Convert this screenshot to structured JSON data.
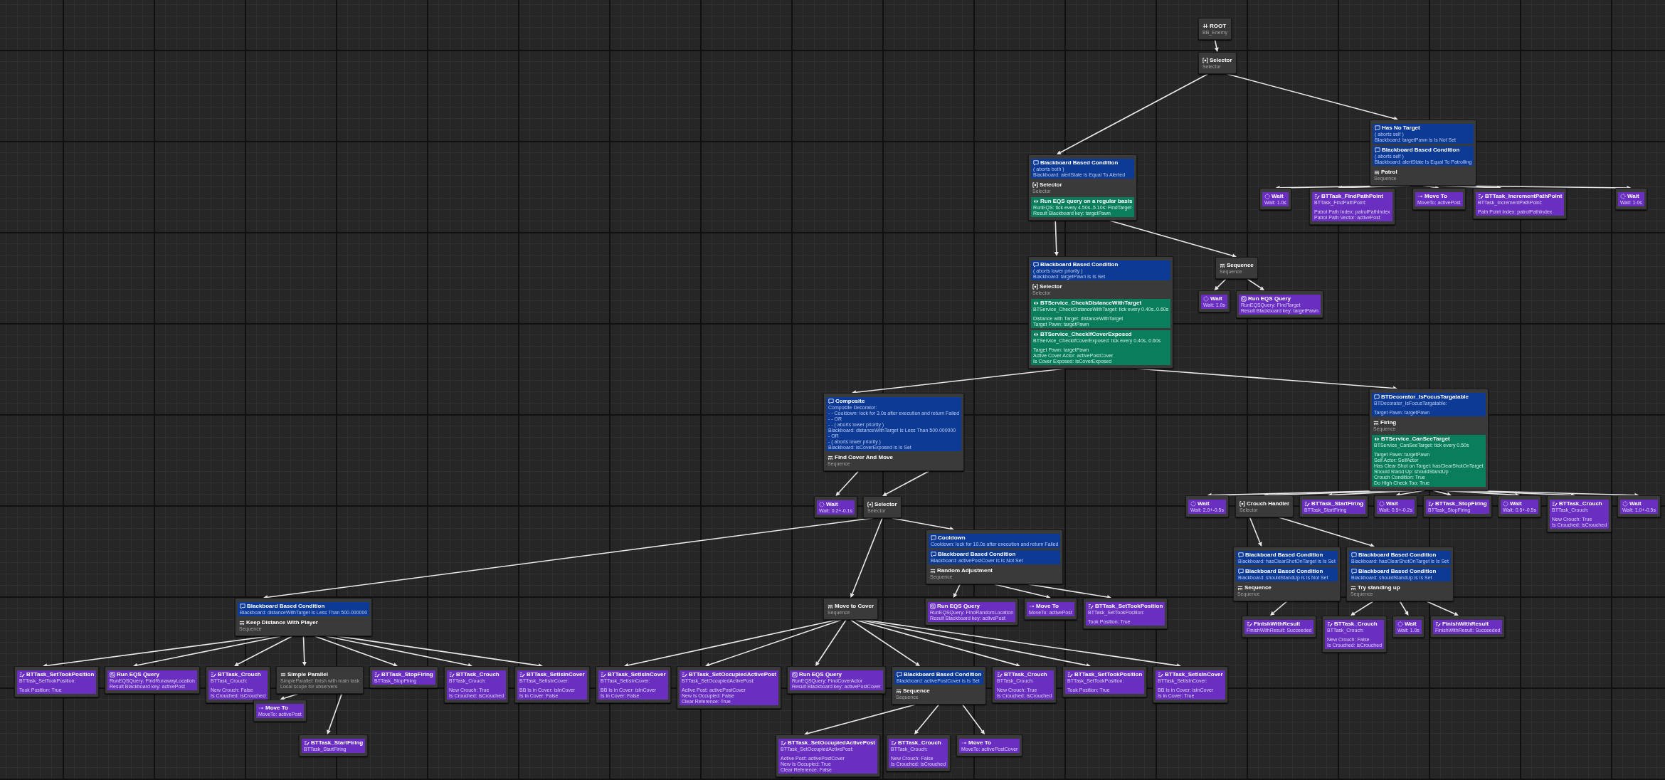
{
  "behavior_tree": {
    "sections": [
      {
        "kind": "root",
        "title": "ROOT",
        "lines": [
          "BB_Enemy"
        ]
      }
    ],
    "children": [
      {
        "sections": [
          {
            "kind": "selector",
            "title": "Selector",
            "lines": [
              "Selector"
            ]
          }
        ],
        "children": [
          {
            "sections": [
              {
                "kind": "decorator",
                "title": "Blackboard Based Condition",
                "lines": [
                  "( aborts both )",
                  "Blackboard: alertState Is Equal To Alerted"
                ]
              },
              {
                "kind": "selector",
                "title": "Selector",
                "lines": [
                  "Selector"
                ]
              },
              {
                "kind": "service",
                "title": "Run EQS query on a regular basis",
                "lines": [
                  "RunEQS: tick every 4.50s..5.10s: FindTarget",
                  "Result Blackboard key: targetPawn"
                ]
              }
            ],
            "children": [
              {
                "sections": [
                  {
                    "kind": "decorator",
                    "title": "Blackboard Based Condition",
                    "lines": [
                      "( aborts lower priority )",
                      "Blackboard: targetPawn is Is Set"
                    ]
                  },
                  {
                    "kind": "selector",
                    "title": "Selector",
                    "lines": [
                      "Selector"
                    ]
                  },
                  {
                    "kind": "service",
                    "title": "BTService_CheckDistanceWithTarget",
                    "lines": [
                      "BTService_CheckDistanceWithTarget: tick every 0.40s..0.60s"
                    ],
                    "details": [
                      "Distance with Target: distanceWithTarget",
                      "Target Pawn: targetPawn"
                    ]
                  },
                  {
                    "kind": "service",
                    "title": "BTService_CheckIfCoverExposed",
                    "lines": [
                      "BTService_CheckIfCoverExposed: tick every 0.40s..0.60s"
                    ],
                    "details": [
                      "Target Pawn: targetPawn",
                      "Active Cover Actor: activePostCover",
                      "Is Cover Exposed: isCoverExposed"
                    ]
                  }
                ],
                "children": [
                  {
                    "sections": [
                      {
                        "kind": "decorator",
                        "title": "Composite",
                        "lines": [
                          "Composite Decorator:",
                          "- - Cooldown: lock for 3.0s after execution and return Failed",
                          "- - OR",
                          "- - ( aborts lower priority )",
                          "Blackboard: distanceWithTarget Is Less Than 500.000000",
                          "- OR",
                          "- ( aborts lower priority )",
                          "Blackboard: isCoverExposed is Is Set"
                        ]
                      },
                      {
                        "kind": "sequence",
                        "title": "Find Cover And Move",
                        "lines": [
                          "Sequence"
                        ]
                      }
                    ],
                    "children": [
                      {
                        "sections": [
                          {
                            "kind": "wait",
                            "title": "Wait",
                            "lines": [
                              "Wait: 0.2+-0.1s"
                            ]
                          }
                        ]
                      },
                      {
                        "sections": [
                          {
                            "kind": "selector",
                            "title": "Selector",
                            "lines": [
                              "Selector"
                            ]
                          }
                        ],
                        "children": [
                          {
                            "sections": [
                              {
                                "kind": "decorator",
                                "title": "Blackboard Based Condition",
                                "lines": [
                                  "Blackboard: distanceWithTarget Is Less Than 500.000000"
                                ]
                              },
                              {
                                "kind": "sequence",
                                "title": "Keep Distance With Player",
                                "lines": [
                                  "Sequence"
                                ]
                              }
                            ],
                            "children": [
                              {
                                "sections": [
                                  {
                                    "kind": "task",
                                    "title": "BTTask_SetTookPosition",
                                    "lines": [
                                      "BTTask_SetTookPosition:"
                                    ],
                                    "details": [
                                      "Took Position: True"
                                    ]
                                  }
                                ]
                              },
                              {
                                "sections": [
                                  {
                                    "kind": "eqs",
                                    "title": "Run EQS Query",
                                    "lines": [
                                      "RunEQSQuery: FindRunawayLocation",
                                      "Result Blackboard key: activePost"
                                    ]
                                  }
                                ]
                              },
                              {
                                "sections": [
                                  {
                                    "kind": "task",
                                    "title": "BTTask_Crouch",
                                    "lines": [
                                      "BTTask_Crouch:"
                                    ],
                                    "details": [
                                      "New Crouch: False",
                                      "Is Crouched: isCrouched"
                                    ]
                                  }
                                ]
                              },
                              {
                                "sections": [
                                  {
                                    "kind": "parallel",
                                    "title": "Simple Parallel",
                                    "lines": [
                                      "SimpleParallel: finish with main task",
                                      "Local scope for observers"
                                    ]
                                  }
                                ],
                                "children": [
                                  {
                                    "sections": [
                                      {
                                        "kind": "move",
                                        "title": "Move To",
                                        "lines": [
                                          "MoveTo: activePost"
                                        ]
                                      }
                                    ]
                                  },
                                  {
                                    "sections": [
                                      {
                                        "kind": "task",
                                        "title": "BTTask_StartFiring",
                                        "lines": [
                                          "BTTask_StartFiring"
                                        ]
                                      }
                                    ]
                                  }
                                ]
                              },
                              {
                                "sections": [
                                  {
                                    "kind": "task",
                                    "title": "BTTask_StopFiring",
                                    "lines": [
                                      "BTTask_StopFiring"
                                    ]
                                  }
                                ]
                              },
                              {
                                "sections": [
                                  {
                                    "kind": "task",
                                    "title": "BTTask_Crouch",
                                    "lines": [
                                      "BTTask_Crouch:"
                                    ],
                                    "details": [
                                      "New Crouch: True",
                                      "Is Crouched: isCrouched"
                                    ]
                                  }
                                ]
                              },
                              {
                                "sections": [
                                  {
                                    "kind": "task",
                                    "title": "BTTask_SetIsInCover",
                                    "lines": [
                                      "BTTask_SetIsInCover:"
                                    ],
                                    "details": [
                                      "BB Is in Cover: isInCover",
                                      "Is in Cover: False"
                                    ]
                                  }
                                ]
                              }
                            ]
                          },
                          {
                            "sections": [
                              {
                                "kind": "sequence",
                                "title": "Move to Cover",
                                "lines": [
                                  "Sequence"
                                ]
                              }
                            ],
                            "children": [
                              {
                                "sections": [
                                  {
                                    "kind": "task",
                                    "title": "BTTask_SetIsInCover",
                                    "lines": [
                                      "BTTask_SetIsInCover:"
                                    ],
                                    "details": [
                                      "BB Is in Cover: isInCover",
                                      "Is in Cover: False"
                                    ]
                                  }
                                ]
                              },
                              {
                                "sections": [
                                  {
                                    "kind": "task",
                                    "title": "BTTask_SetOccupiedActivePost",
                                    "lines": [
                                      "BTTask_SetOccupiedActivePost:"
                                    ],
                                    "details": [
                                      "Active Post: activePostCover",
                                      "New Is Occupied: False",
                                      "Clear Reference: True"
                                    ]
                                  }
                                ]
                              },
                              {
                                "sections": [
                                  {
                                    "kind": "eqs",
                                    "title": "Run EQS Query",
                                    "lines": [
                                      "RunEQSQuery: FindCoverActor",
                                      "Result Blackboard key: activePostCover"
                                    ]
                                  }
                                ]
                              },
                              {
                                "sections": [
                                  {
                                    "kind": "decorator",
                                    "title": "Blackboard Based Condition",
                                    "lines": [
                                      "Blackboard: activePostCover is Is Set"
                                    ]
                                  },
                                  {
                                    "kind": "sequence",
                                    "title": "Sequence",
                                    "lines": [
                                      "Sequence"
                                    ]
                                  }
                                ],
                                "children": [
                                  {
                                    "sections": [
                                      {
                                        "kind": "task",
                                        "title": "BTTask_SetOccupiedActivePost",
                                        "lines": [
                                          "BTTask_SetOccupiedActivePost:"
                                        ],
                                        "details": [
                                          "Active Post: activePostCover",
                                          "New Is Occupied: True",
                                          "Clear Reference: False"
                                        ]
                                      }
                                    ]
                                  },
                                  {
                                    "sections": [
                                      {
                                        "kind": "task",
                                        "title": "BTTask_Crouch",
                                        "lines": [
                                          "BTTask_Crouch:"
                                        ],
                                        "details": [
                                          "New Crouch: False",
                                          "Is Crouched: isCrouched"
                                        ]
                                      }
                                    ]
                                  },
                                  {
                                    "sections": [
                                      {
                                        "kind": "move",
                                        "title": "Move To",
                                        "lines": [
                                          "MoveTo: activePostCover"
                                        ]
                                      }
                                    ]
                                  }
                                ]
                              },
                              {
                                "sections": [
                                  {
                                    "kind": "task",
                                    "title": "BTTask_Crouch",
                                    "lines": [
                                      "BTTask_Crouch:"
                                    ],
                                    "details": [
                                      "New Crouch: True",
                                      "Is Crouched: isCrouched"
                                    ]
                                  }
                                ]
                              },
                              {
                                "sections": [
                                  {
                                    "kind": "task",
                                    "title": "BTTask_SetTookPosition",
                                    "lines": [
                                      "BTTask_SetTookPosition:"
                                    ],
                                    "details": [
                                      "Took Position: True"
                                    ]
                                  }
                                ]
                              },
                              {
                                "sections": [
                                  {
                                    "kind": "task",
                                    "title": "BTTask_SetIsInCover",
                                    "lines": [
                                      "BTTask_SetIsInCover:"
                                    ],
                                    "details": [
                                      "BB Is in Cover: isInCover",
                                      "Is in Cover: True"
                                    ]
                                  }
                                ]
                              }
                            ]
                          },
                          {
                            "sections": [
                              {
                                "kind": "decorator",
                                "title": "Cooldown",
                                "lines": [
                                  "Cooldown: lock for 10.0s after execution and return Failed"
                                ]
                              },
                              {
                                "kind": "decorator",
                                "title": "Blackboard Based Condition",
                                "lines": [
                                  "Blackboard: activePostCover is Is Not Set"
                                ]
                              },
                              {
                                "kind": "sequence",
                                "title": "Random Adjustment",
                                "lines": [
                                  "Sequence"
                                ]
                              }
                            ],
                            "children": [
                              {
                                "sections": [
                                  {
                                    "kind": "eqs",
                                    "title": "Run EQS Query",
                                    "lines": [
                                      "RunEQSQuery: FindRandomLocation",
                                      "Result Blackboard key: activePost"
                                    ]
                                  }
                                ]
                              },
                              {
                                "sections": [
                                  {
                                    "kind": "move",
                                    "title": "Move To",
                                    "lines": [
                                      "MoveTo: activePost"
                                    ]
                                  }
                                ]
                              },
                              {
                                "sections": [
                                  {
                                    "kind": "task",
                                    "title": "BTTask_SetTookPosition",
                                    "lines": [
                                      "BTTask_SetTookPosition:"
                                    ],
                                    "details": [
                                      "Took Position: True"
                                    ]
                                  }
                                ]
                              }
                            ]
                          }
                        ]
                      }
                    ]
                  },
                  {
                    "sections": [
                      {
                        "kind": "decorator",
                        "title": "BTDecorator_IsFocusTargatable",
                        "lines": [
                          "BTDecorator_IsFocusTargatable:"
                        ],
                        "details": [
                          "Target Pawn: targetPawn"
                        ]
                      },
                      {
                        "kind": "sequence",
                        "title": "Firing",
                        "lines": [
                          "Sequence"
                        ]
                      },
                      {
                        "kind": "service",
                        "title": "BTService_CanSeeTarget",
                        "lines": [
                          "BTService_CanSeeTarget: tick every 0.50s"
                        ],
                        "details": [
                          "Target Pawn: targetPawn",
                          "Self Actor: SelfActor",
                          "Has Clear Shot on Target: hasClearShotOnTarget",
                          "Should Stand Up: shouldStandUp",
                          "Crouch Condition: True",
                          "Do High Check Too: True"
                        ]
                      }
                    ],
                    "children": [
                      {
                        "sections": [
                          {
                            "kind": "wait",
                            "title": "Wait",
                            "lines": [
                              "Wait: 2.0+-0.5s"
                            ]
                          }
                        ]
                      },
                      {
                        "sections": [
                          {
                            "kind": "selector",
                            "title": "Crouch Handler",
                            "lines": [
                              "Selector"
                            ]
                          }
                        ],
                        "children": [
                          {
                            "sections": [
                              {
                                "kind": "decorator",
                                "title": "Blackboard Based Condition",
                                "lines": [
                                  "Blackboard: hasClearShotOnTarget is Is Set"
                                ]
                              },
                              {
                                "kind": "decorator",
                                "title": "Blackboard Based Condition",
                                "lines": [
                                  "Blackboard: shouldStandUp is Is Not Set"
                                ]
                              },
                              {
                                "kind": "sequence",
                                "title": "Sequence",
                                "lines": [
                                  "Sequence"
                                ]
                              }
                            ],
                            "children": [
                              {
                                "sections": [
                                  {
                                    "kind": "task",
                                    "title": "FinishWithResult",
                                    "lines": [
                                      "FinishWithResult: Succeeded"
                                    ]
                                  }
                                ]
                              }
                            ]
                          },
                          {
                            "sections": [
                              {
                                "kind": "decorator",
                                "title": "Blackboard Based Condition",
                                "lines": [
                                  "Blackboard: hasClearShotOnTarget is Is Set"
                                ]
                              },
                              {
                                "kind": "decorator",
                                "title": "Blackboard Based Condition",
                                "lines": [
                                  "Blackboard: shouldStandUp is Is Set"
                                ]
                              },
                              {
                                "kind": "sequence",
                                "title": "Try standing up",
                                "lines": [
                                  "Sequence"
                                ]
                              }
                            ],
                            "children": [
                              {
                                "sections": [
                                  {
                                    "kind": "task",
                                    "title": "BTTask_Crouch",
                                    "lines": [
                                      "BTTask_Crouch:"
                                    ],
                                    "details": [
                                      "New Crouch: False",
                                      "Is Crouched: isCrouched"
                                    ]
                                  }
                                ]
                              },
                              {
                                "sections": [
                                  {
                                    "kind": "wait",
                                    "title": "Wait",
                                    "lines": [
                                      "Wait: 1.0s"
                                    ]
                                  }
                                ]
                              },
                              {
                                "sections": [
                                  {
                                    "kind": "task",
                                    "title": "FinishWithResult",
                                    "lines": [
                                      "FinishWithResult: Succeeded"
                                    ]
                                  }
                                ]
                              }
                            ]
                          }
                        ]
                      },
                      {
                        "sections": [
                          {
                            "kind": "task",
                            "title": "BTTask_StartFiring",
                            "lines": [
                              "BTTask_StartFiring"
                            ]
                          }
                        ]
                      },
                      {
                        "sections": [
                          {
                            "kind": "wait",
                            "title": "Wait",
                            "lines": [
                              "Wait: 0.5+-0.2s"
                            ]
                          }
                        ]
                      },
                      {
                        "sections": [
                          {
                            "kind": "task",
                            "title": "BTTask_StopFiring",
                            "lines": [
                              "BTTask_StopFiring"
                            ]
                          }
                        ]
                      },
                      {
                        "sections": [
                          {
                            "kind": "wait",
                            "title": "Wait",
                            "lines": [
                              "Wait: 0.5+-0.5s"
                            ]
                          }
                        ]
                      },
                      {
                        "sections": [
                          {
                            "kind": "task",
                            "title": "BTTask_Crouch",
                            "lines": [
                              "BTTask_Crouch:"
                            ],
                            "details": [
                              "New Crouch: True",
                              "Is Crouched: isCrouched"
                            ]
                          }
                        ]
                      },
                      {
                        "sections": [
                          {
                            "kind": "wait",
                            "title": "Wait",
                            "lines": [
                              "Wait: 1.0+-0.5s"
                            ]
                          }
                        ]
                      }
                    ]
                  }
                ]
              },
              {
                "sections": [
                  {
                    "kind": "sequence",
                    "title": "Sequence",
                    "lines": [
                      "Sequence"
                    ]
                  }
                ],
                "children": [
                  {
                    "sections": [
                      {
                        "kind": "wait",
                        "title": "Wait",
                        "lines": [
                          "Wait: 1.0s"
                        ]
                      }
                    ]
                  },
                  {
                    "sections": [
                      {
                        "kind": "eqs",
                        "title": "Run EQS Query",
                        "lines": [
                          "RunEQSQuery: FindTarget",
                          "Result Blackboard key: targetPawn"
                        ]
                      }
                    ]
                  }
                ]
              }
            ]
          },
          {
            "sections": [
              {
                "kind": "decorator",
                "title": "Has No Target",
                "lines": [
                  "( aborts self )",
                  "Blackboard: targetPawn is Is Not Set"
                ]
              },
              {
                "kind": "decorator",
                "title": "Blackboard Based Condition",
                "lines": [
                  "( aborts self )",
                  "Blackboard: alertState Is Equal To Patrolling"
                ]
              },
              {
                "kind": "sequence",
                "title": "Patrol",
                "lines": [
                  "Sequence"
                ]
              }
            ],
            "children": [
              {
                "sections": [
                  {
                    "kind": "wait",
                    "title": "Wait",
                    "lines": [
                      "Wait: 1.0s"
                    ]
                  }
                ]
              },
              {
                "sections": [
                  {
                    "kind": "task",
                    "title": "BTTask_FindPathPoint",
                    "lines": [
                      "BTTask_FindPathPoint:"
                    ],
                    "details": [
                      "Patrol Path Index: patrolPathIndex",
                      "Patrol Path Vector: activePost"
                    ]
                  }
                ]
              },
              {
                "sections": [
                  {
                    "kind": "move",
                    "title": "Move To",
                    "lines": [
                      "MoveTo: activePost"
                    ]
                  }
                ]
              },
              {
                "sections": [
                  {
                    "kind": "task",
                    "title": "BTTask_IncrementPathPoint",
                    "lines": [
                      "BTTask_IncrementPathPoint:"
                    ],
                    "details": [
                      "Path Point Index: patrolPathIndex"
                    ]
                  }
                ]
              },
              {
                "sections": [
                  {
                    "kind": "wait",
                    "title": "Wait",
                    "lines": [
                      "Wait: 1.0s"
                    ]
                  }
                ]
              }
            ]
          }
        ]
      }
    ]
  }
}
